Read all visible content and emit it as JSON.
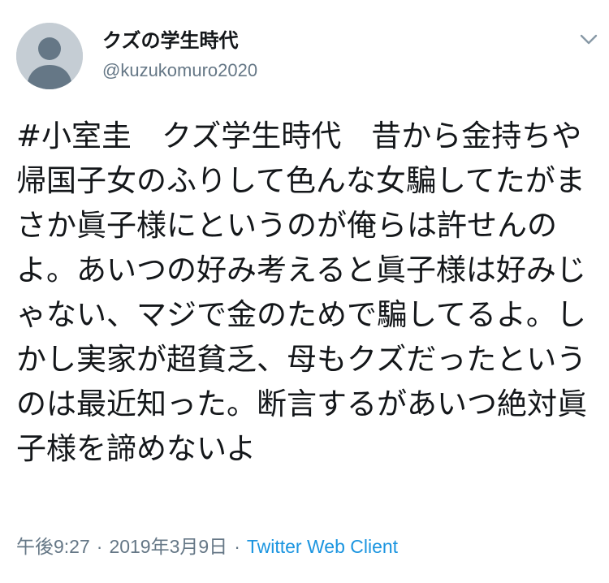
{
  "tweet": {
    "display_name": "クズの学生時代",
    "handle": "@kuzukomuro2020",
    "text": "#小室圭　クズ学生時代　昔から金持ちや帰国子女のふりして色んな女騙してたがまさか眞子様にというのが俺らは許せんのよ。あいつの好み考えると眞子様は好みじゃない、マジで金のためで騙してるよ。しかし実家が超貧乏、母もクズだったというのは最近知った。断言するがあいつ絶対眞子様を諦めないよ",
    "time": "午後9:27",
    "date": "2019年3月9日",
    "separator": "·",
    "client": "Twitter Web Client"
  },
  "icons": {
    "avatar": "default-profile-icon",
    "menu": "chevron-down-icon"
  },
  "colors": {
    "text": "#14171a",
    "secondary": "#657786",
    "link": "#1b95e0",
    "avatar_bg": "#c5cdd4"
  }
}
